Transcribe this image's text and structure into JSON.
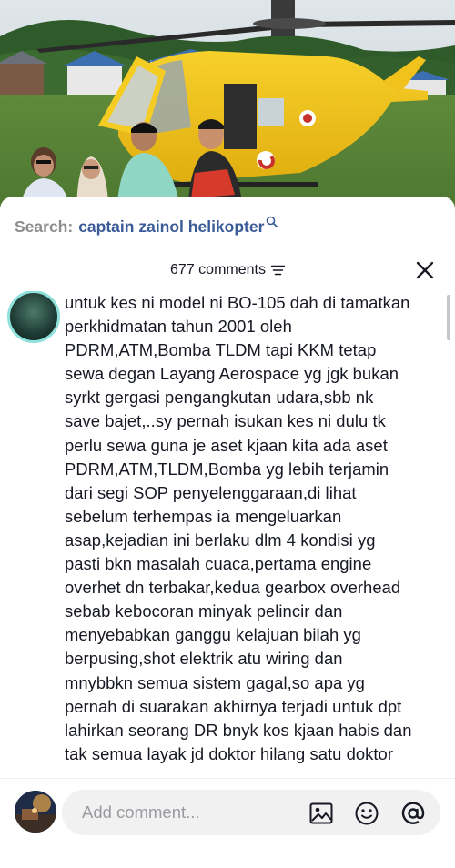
{
  "search": {
    "prefix": "Search:",
    "query": "captain zainol helikopter"
  },
  "comments_header": {
    "count_label": "677 comments"
  },
  "comment": {
    "lines": [
      "untuk kes ni model ni BO-105 dah di tamatkan",
      "perkhidmatan tahun 2001 oleh",
      "PDRM,ATM,Bomba TLDM tapi KKM tetap",
      "sewa degan Layang Aerospace yg jgk bukan",
      "syrkt gergasi pengangkutan udara,sbb nk",
      "save bajet,..sy pernah isukan kes ni dulu tk",
      "perlu sewa guna je aset kjaan kita ada aset",
      "PDRM,ATM,TLDM,Bomba yg lebih terjamin",
      "dari segi SOP penyelenggaraan,di lihat",
      "sebelum terhempas ia mengeluarkan",
      "asap,kejadian ini berlaku dlm 4 kondisi yg",
      "pasti bkn masalah cuaca,pertama engine",
      "overhet dn terbakar,kedua gearbox overhead",
      "sebab kebocoran minyak pelincir dan",
      "menyebabkan ganggu kelajuan bilah yg",
      "berpusing,shot elektrik atu wiring dan",
      "mnybbkn semua sistem gagal,so apa yg",
      "pernah di suarakan akhirnya terjadi untuk dpt",
      "lahirkan seorang DR bnyk kos kjaan habis dan",
      "tak semua layak jd doktor hilang satu doktor"
    ]
  },
  "input": {
    "placeholder": "Add comment..."
  },
  "icons": {
    "search": "search-icon",
    "filter": "filter-icon",
    "close": "close-icon",
    "image": "image-icon",
    "emoji": "emoji-icon",
    "mention": "mention-icon"
  },
  "colors": {
    "search_query": "#3a5a98",
    "search_prefix": "#8c8c8c",
    "text": "#161823",
    "input_bg": "#f1f1f2",
    "avatar_ring": "#8fe1dc",
    "helicopter_yellow": "#f2c21a"
  }
}
